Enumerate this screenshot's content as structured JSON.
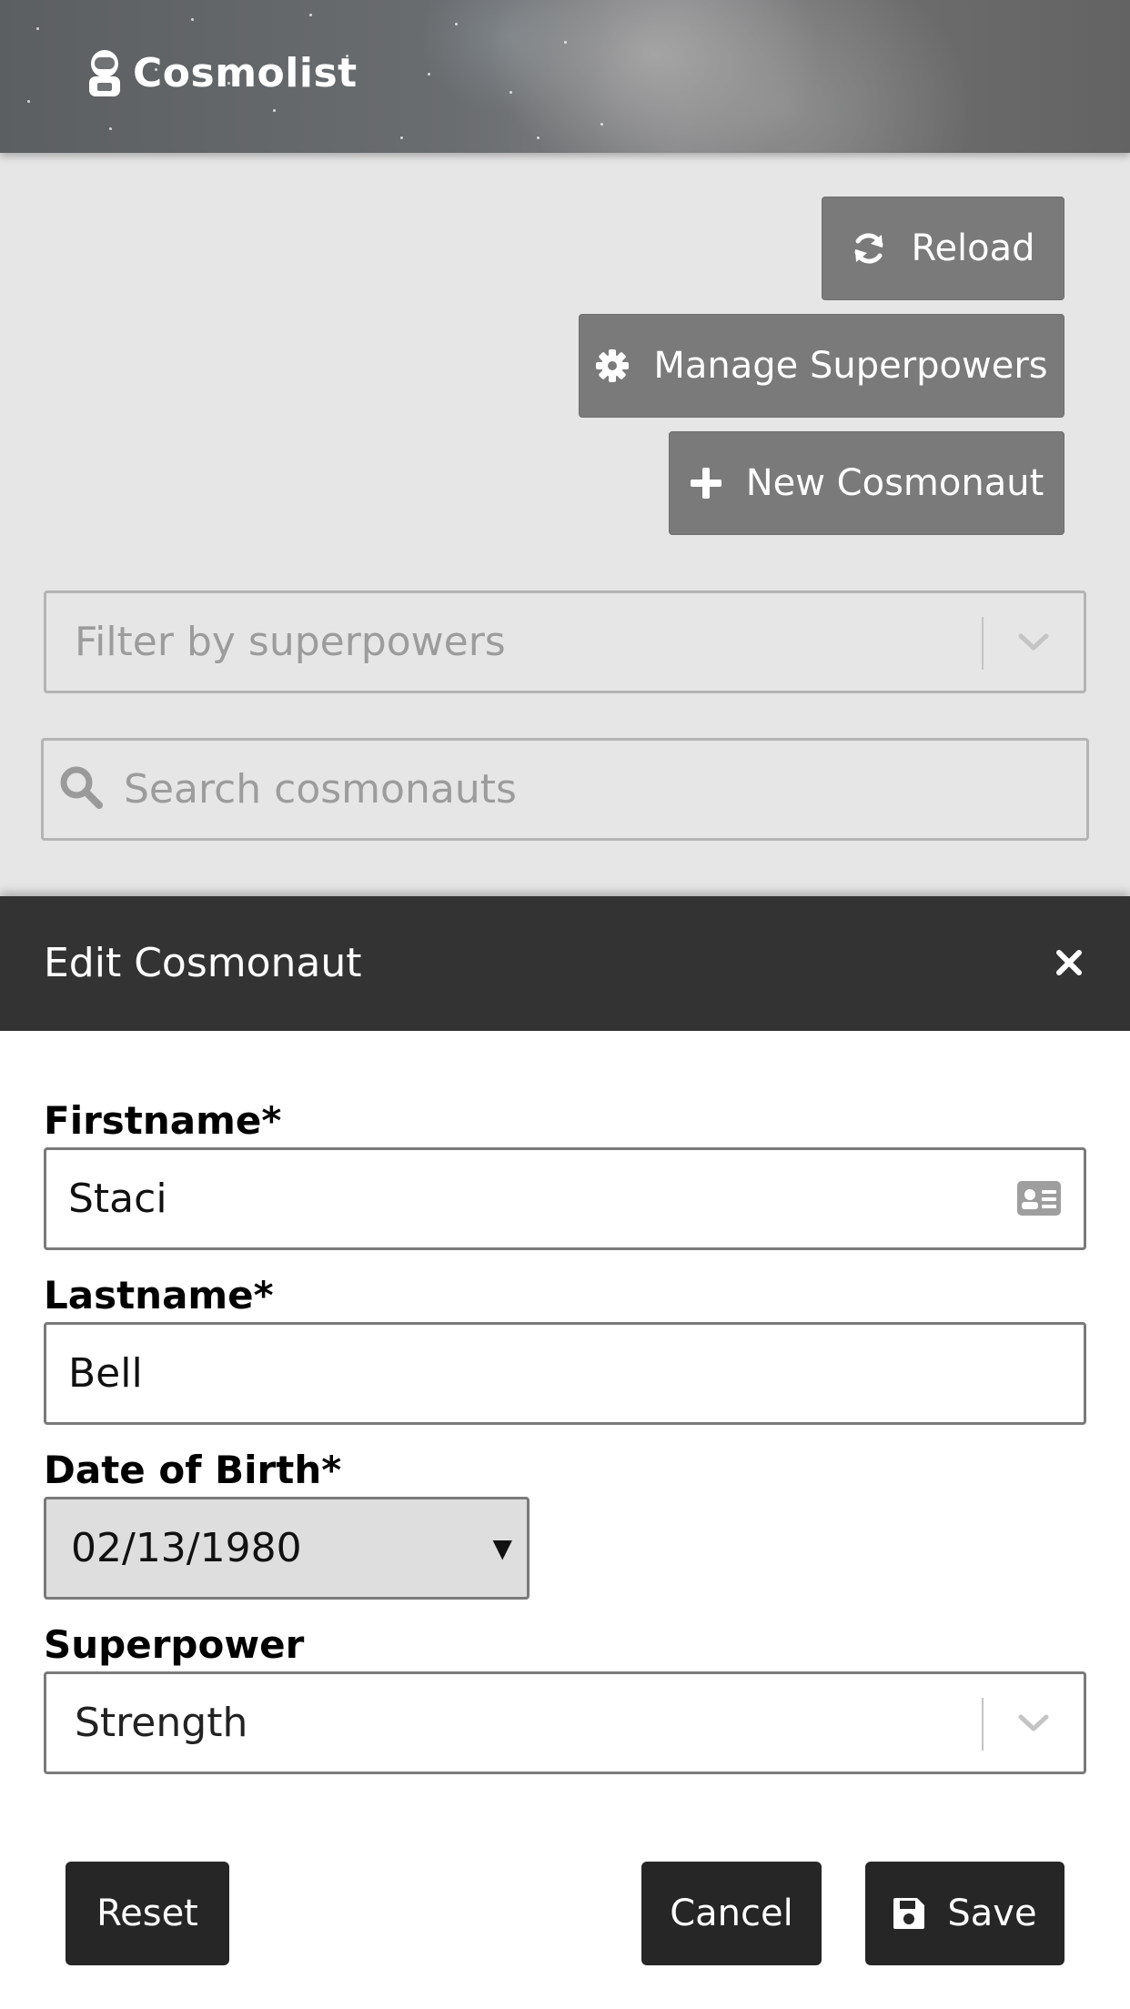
{
  "app": {
    "brand_name": "Cosmolist"
  },
  "toolbar": {
    "reload_label": "Reload",
    "manage_superpowers_label": "Manage Superpowers",
    "new_cosmonaut_label": "New Cosmonaut"
  },
  "filter": {
    "placeholder": "Filter by superpowers"
  },
  "search": {
    "placeholder": "Search cosmonauts",
    "value": ""
  },
  "modal": {
    "title": "Edit Cosmonaut",
    "fields": {
      "firstname_label": "Firstname*",
      "firstname_value": "Staci",
      "lastname_label": "Lastname*",
      "lastname_value": "Bell",
      "dob_label": "Date of Birth*",
      "dob_value": "02/13/1980",
      "dob_arrow": "▼",
      "superpower_label": "Superpower",
      "superpower_value": "Strength"
    },
    "buttons": {
      "reset_label": "Reset",
      "cancel_label": "Cancel",
      "save_label": "Save"
    }
  },
  "icons": {
    "logo": "astronaut-icon",
    "reload": "sync-icon",
    "manage": "gear-icon",
    "new": "plus-icon",
    "filter_toggle": "chevron-down-icon",
    "search": "search-icon",
    "close": "close-icon",
    "firstname_adornment": "contact-card-icon",
    "save": "floppy-disk-icon"
  },
  "colors": {
    "page_background": "#e6e6e6",
    "toolbar_button": "#7a7a7a",
    "modal_header": "#333333",
    "dark_button": "#262626"
  }
}
